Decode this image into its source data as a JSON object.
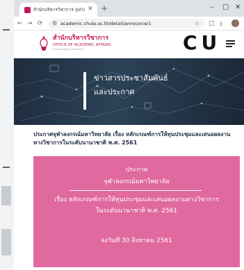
{
  "browser": {
    "tab_title": "สำนักบริหารวิชาการ จุฬาลงกรณ์มห...",
    "new_tab_label": "+",
    "url": "academic.chula.ac.th/detail/announce/1"
  },
  "site": {
    "logo_th": "สำนักบริหารวิชาการ",
    "logo_en": "OFFICE OF ACADEMIC AFFAIRS",
    "logo_sub": "Chulalongkorn University",
    "brand_mark": "CU"
  },
  "hero": {
    "title_line1": "ข่าวสารประชาสัมพันธ์",
    "title_line2": "และประกาศ"
  },
  "article": {
    "headline": "ประกาศจุฬาลงกรณ์มหาวิทยาลัย เรื่อง หลักเกณฑ์การให้ทุนประชุมและเสนอผลงานทางวิชาการในระดับนานาชาติ พ.ศ. 2561"
  },
  "notice": {
    "line1": "ประกาศ",
    "line2": "จุฬาลงกรณ์มหาวิทยาลัย",
    "line3": "เรื่อง หลักเกณฑ์การให้ทุนประชุมและเสนอผลงานทางวิชาการ",
    "line4": "ในระดับนานาชาติ พ.ศ. 2561",
    "signed_date": "ลงวันที่ 30 สิงหาคม 2561"
  },
  "colors": {
    "brand_pink": "#c2185b",
    "notice_pink": "#e0699f",
    "hero_dark": "#1e2c3d"
  }
}
